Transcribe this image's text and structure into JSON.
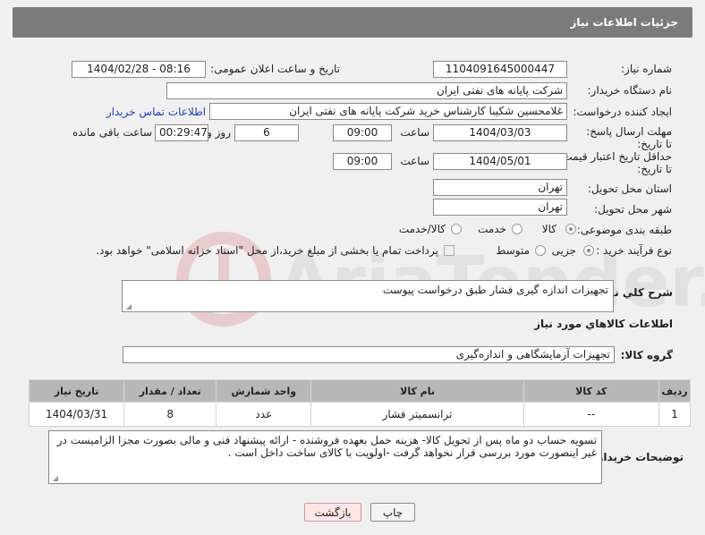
{
  "header": {
    "title": "جزئیات اطلاعات نیاز"
  },
  "fields": {
    "need_number_label": "شماره نیاز:",
    "need_number": "1104091645000447",
    "announce_label": "تاریخ و ساعت اعلان عمومی:",
    "announce_value": "1404/02/28 - 08:16",
    "buyer_org_label": "نام دستگاه خریدار:",
    "buyer_org": "شرکت پایانه های نفتی ایران",
    "requester_label": "ایجاد کننده درخواست:",
    "requester": "غلامحسین شکیبا کارشناس خرید شرکت پایانه های نفتی ایران",
    "contact_link": "اطلاعات تماس خریدار",
    "reply_deadline_label": "مهلت ارسال پاسخ: تا تاریخ:",
    "reply_date": "1404/03/03",
    "time_label": "ساعت",
    "reply_time": "09:00",
    "days_value": "6",
    "days_label": "روز و",
    "remaining_value": "00:29:47",
    "remaining_label": "ساعت باقی مانده",
    "price_validity_label": "حداقل تاریخ اعتبار قیمت: تا تاریخ:",
    "price_date": "1404/05/01",
    "price_time": "09:00",
    "province_label": "استان محل تحویل:",
    "province": "تهران",
    "city_label": "شهر محل تحویل:",
    "city": "تهران",
    "category_label": "طبقه بندی موضوعی:",
    "category_options": [
      "کالا",
      "خدمت",
      "کالا/خدمت"
    ],
    "process_label": "نوع فرآیند خرید :",
    "process_options": [
      "جزیی",
      "متوسط"
    ],
    "payment_note": "پرداخت تمام یا بخشی از مبلغ خرید،از محل \"اسناد خزانه اسلامی\" خواهد بود."
  },
  "summary": {
    "label": "شرح کلي نياز:",
    "text": "تجهیزات اندازه گیری فشار طبق درخواست پیوست"
  },
  "goods_section": {
    "title": "اطلاعات کالاهاي مورد نياز",
    "group_label": "گروه کالا:",
    "group_value": "تجهیزات آزمایشگاهی و اندازه‌گیری"
  },
  "table": {
    "headers": [
      "ردیف",
      "کد کالا",
      "نام کالا",
      "واحد شمارش",
      "تعداد / مقدار",
      "تاریخ نیاز"
    ],
    "rows": [
      [
        "1",
        "--",
        "ترانسمیتر فشار",
        "عدد",
        "8",
        "1404/03/31"
      ]
    ]
  },
  "buyer_notes": {
    "label": "توضیحات خریدار:",
    "text": "تسویه حساب دو ماه پس از تحویل کالا- هزینه حمل بعهده فروشنده - ارائه پیشنهاد فنی و مالی بصورت مجزا الزامیست در غیر اینصورت مورد بررسی قرار نخواهد گرفت -اولویت با کالای ساخت داخل است ."
  },
  "buttons": {
    "print": "چاپ",
    "back": "بازگشت"
  },
  "watermark": "AriaTender.neT"
}
